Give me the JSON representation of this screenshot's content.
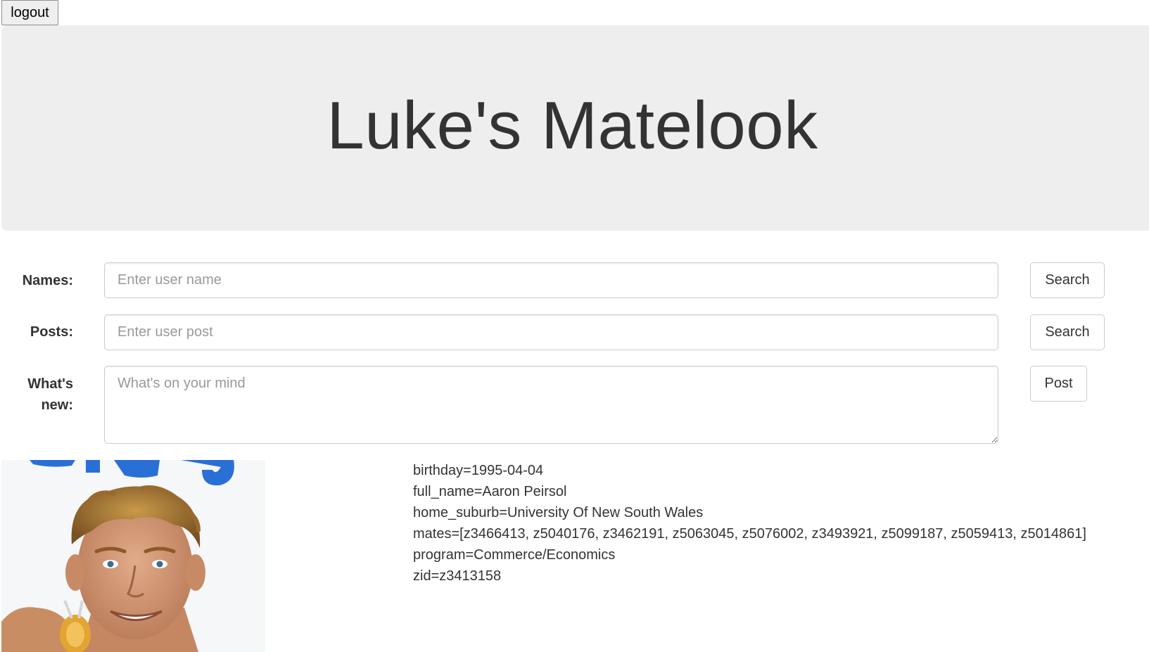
{
  "header": {
    "logout_label": "logout",
    "title": "Luke's Matelook"
  },
  "search_names": {
    "label": "Names:",
    "placeholder": "Enter user name",
    "button_label": "Search"
  },
  "search_posts": {
    "label": "Posts:",
    "placeholder": "Enter user post",
    "button_label": "Search"
  },
  "new_post": {
    "label_line1": "What's",
    "label_line2": "new:",
    "placeholder": "What's on your mind",
    "button_label": "Post"
  },
  "profile": {
    "photo_icon": "profile-photo",
    "details": [
      "birthday=1995-04-04",
      "full_name=Aaron Peirsol",
      "home_suburb=University Of New South Wales",
      "mates=[z3466413, z5040176, z3462191, z5063045, z5076002, z3493921, z5099187, z5059413, z5014861]",
      "program=Commerce/Economics",
      "zid=z3413158"
    ]
  },
  "colors": {
    "jumbotron_bg": "#eeeeee",
    "text": "#333333",
    "input_border": "#cccccc",
    "placeholder": "#999999"
  }
}
